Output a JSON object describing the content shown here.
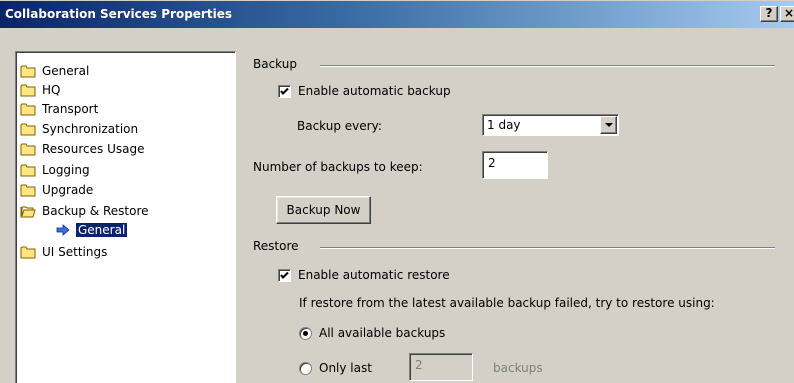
{
  "window": {
    "title": "Collaboration Services Properties",
    "help_button": "?",
    "close_button": "×"
  },
  "tree": {
    "items": [
      {
        "label": "General"
      },
      {
        "label": "HQ"
      },
      {
        "label": "Transport"
      },
      {
        "label": "Synchronization"
      },
      {
        "label": "Resources Usage"
      },
      {
        "label": "Logging"
      },
      {
        "label": "Upgrade"
      },
      {
        "label": "Backup & Restore"
      },
      {
        "label": "General"
      },
      {
        "label": "UI Settings"
      }
    ]
  },
  "backup": {
    "group_label": "Backup",
    "enable_label": "Enable automatic backup",
    "enable_checked": true,
    "every_label": "Backup every:",
    "every_value": "1 day",
    "keep_label": "Number of backups to keep:",
    "keep_value": "2",
    "backup_now_label": "Backup Now"
  },
  "restore": {
    "group_label": "Restore",
    "enable_label": "Enable automatic restore",
    "enable_checked": true,
    "fallback_text": "If restore from the latest available backup failed, try to restore using:",
    "all_label": "All available backups",
    "all_selected": true,
    "only_last_label": "Only last",
    "only_last_value": "2",
    "backups_suffix": "backups"
  },
  "colors": {
    "title_gradient_start": "#0a246a",
    "title_gradient_end": "#a6caf0",
    "dialog_bg": "#d4d0c8",
    "selection": "#0a246a"
  }
}
